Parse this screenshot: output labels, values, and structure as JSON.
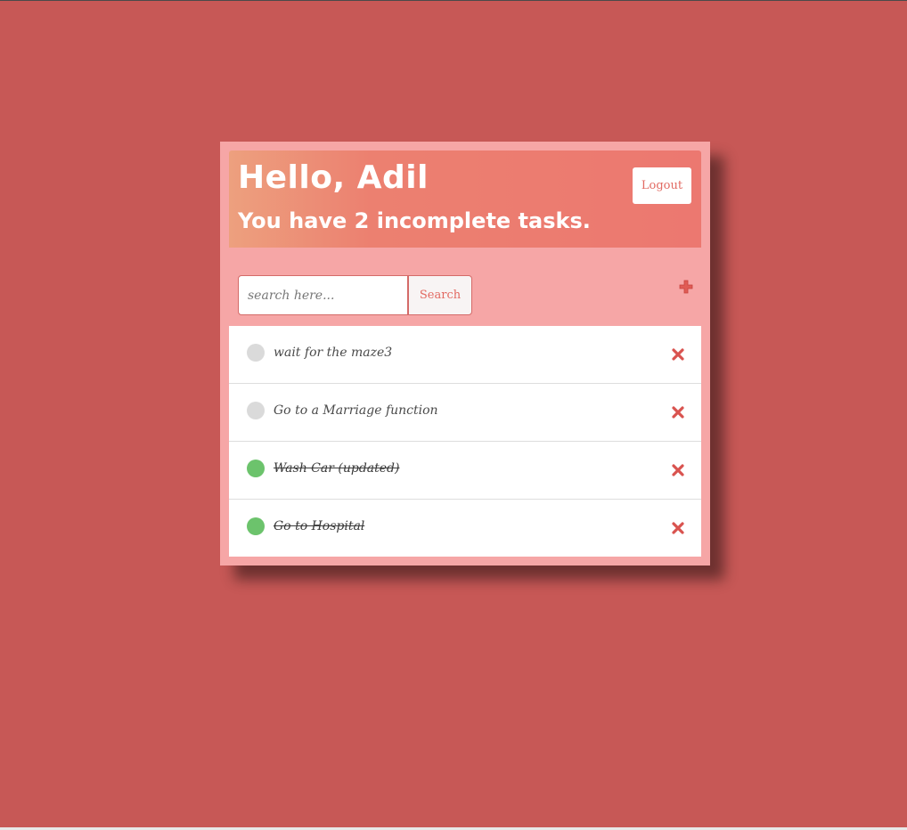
{
  "colors": {
    "background": "#c75856",
    "card": "#f6a6a6",
    "header_accent": "#ec7870",
    "accent_text": "#e26a62",
    "done_toggle": "#6cc36c",
    "todo_toggle": "#dadada",
    "delete_icon": "#d9534f"
  },
  "header": {
    "greeting": "Hello, Adil",
    "summary": "You have 2 incomplete tasks.",
    "logout_label": "Logout"
  },
  "search": {
    "placeholder": "search here...",
    "value": "",
    "button_label": "Search"
  },
  "icons": {
    "add": "plus-icon",
    "delete": "close-icon",
    "toggle": "circle-checkbox-icon"
  },
  "tasks": [
    {
      "label": "wait for the maze3",
      "completed": false
    },
    {
      "label": "Go to a Marriage function",
      "completed": false
    },
    {
      "label": "Wash Car (updated)",
      "completed": true
    },
    {
      "label": "Go to Hospital",
      "completed": true
    }
  ]
}
